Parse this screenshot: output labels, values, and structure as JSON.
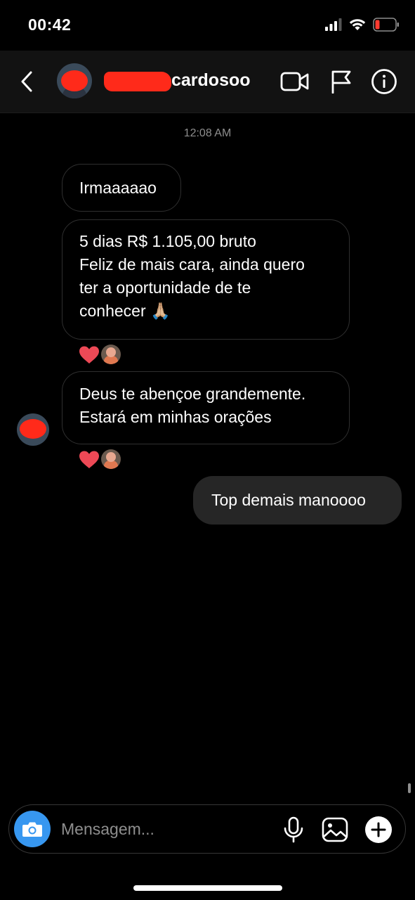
{
  "status_bar": {
    "time": "00:42",
    "icons": [
      "signal-icon",
      "wifi-icon",
      "battery-low-icon"
    ],
    "battery_color": "#ff3b30"
  },
  "header": {
    "username": "cardosoo",
    "icons": [
      "back-chevron-icon",
      "video-call-icon",
      "flag-icon",
      "info-icon"
    ]
  },
  "thread": {
    "timestamp": "12:08 AM",
    "messages": [
      {
        "direction": "incoming",
        "lines": [
          "Irmaaaaao"
        ]
      },
      {
        "direction": "incoming",
        "lines": [
          "5 dias R$ 1.105,00 bruto",
          "Feliz de mais cara, ainda quero",
          "ter a oportunidade de te",
          "conhecer 🙏🏼"
        ],
        "reaction": "❤️"
      },
      {
        "direction": "incoming",
        "lines": [
          "Deus te abençoe grandemente.",
          "Estará em minhas orações"
        ],
        "reaction": "❤️"
      },
      {
        "direction": "outgoing",
        "lines": [
          "Top demais manoooo"
        ]
      }
    ]
  },
  "composer": {
    "placeholder": "Mensagem...",
    "icons": [
      "camera-icon",
      "microphone-icon",
      "gallery-icon",
      "plus-icon"
    ]
  },
  "colors": {
    "background": "#000000",
    "incoming_border": "#2f2f2f",
    "outgoing_bubble": "#262626",
    "camera_button": "#3797f0",
    "heart": "#ed4956",
    "redaction": "#ff2a1a"
  }
}
